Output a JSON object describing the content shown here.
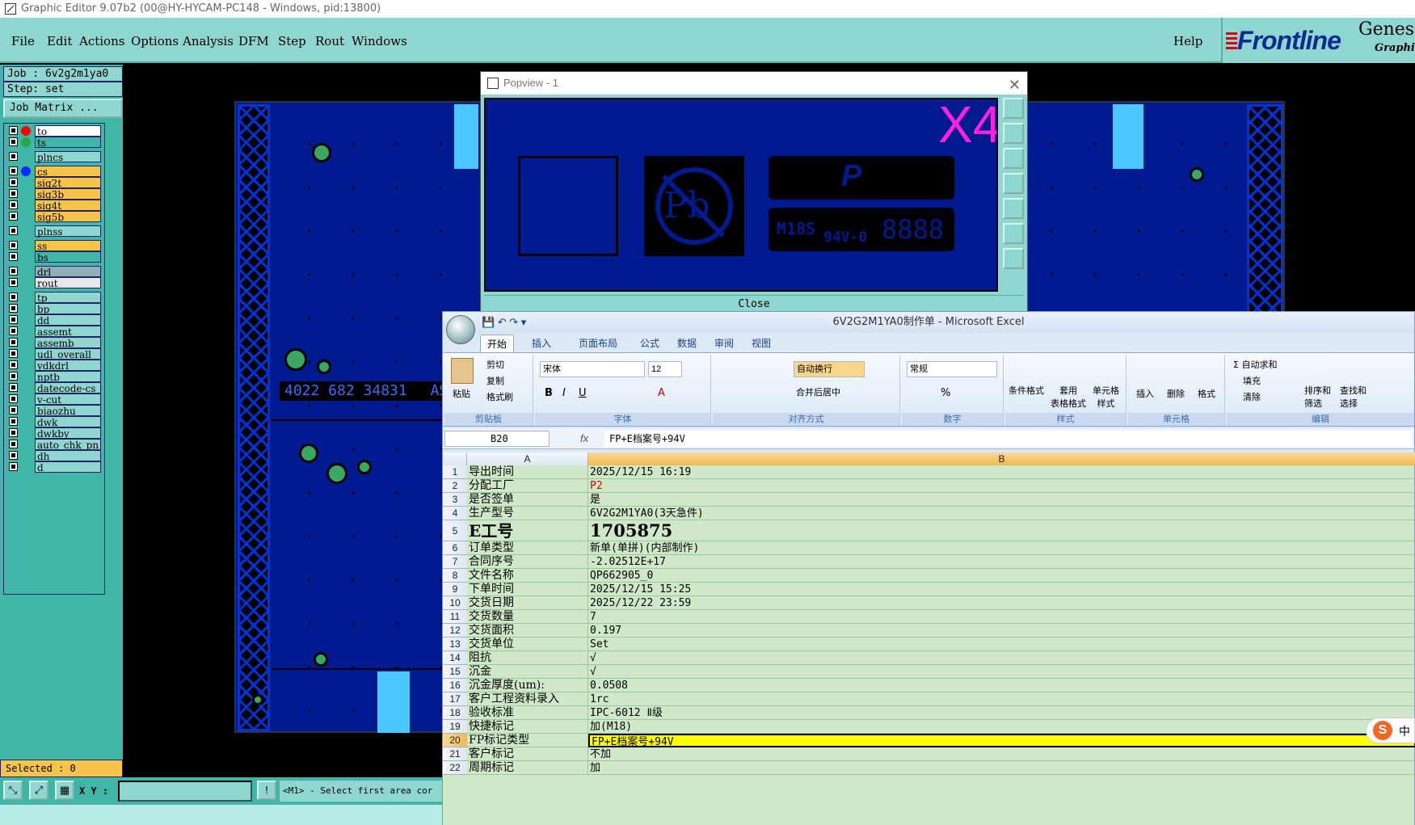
{
  "window": {
    "title": "Graphic Editor 9.07b2 (00@HY-HYCAM-PC148 - Windows, pid:13800)"
  },
  "menubar": {
    "items": [
      "File",
      "Edit",
      "Actions",
      "Options",
      "Analysis",
      "DFM",
      "Step",
      "Rout",
      "Windows"
    ],
    "help": "Help",
    "brand": {
      "logo": "Frontline",
      "product": "Genesis",
      "sub": "Graphic"
    }
  },
  "leftpanel": {
    "job": "Job :  6v2g2m1ya0",
    "step": "Step:  set",
    "job_matrix": "Job Matrix ...",
    "selected": "Selected : 0",
    "layers": [
      {
        "name": "to",
        "color": "#ffffff",
        "dot": "#ff0000"
      },
      {
        "name": "ts",
        "color": "#3fb6a8",
        "dot": "#2aa84a"
      },
      {
        "name": "plncs",
        "color": "#8fd6d0",
        "dot": ""
      },
      {
        "name": "cs",
        "color": "#f7c44a",
        "dot": "#0a2cff"
      },
      {
        "name": "sig2t",
        "color": "#f7c44a",
        "dot": ""
      },
      {
        "name": "sig3b",
        "color": "#f7c44a",
        "dot": ""
      },
      {
        "name": "sig4t",
        "color": "#f7c44a",
        "dot": ""
      },
      {
        "name": "sig5b",
        "color": "#f7c44a",
        "dot": ""
      },
      {
        "name": "plnss",
        "color": "#8fd6d0",
        "dot": ""
      },
      {
        "name": "ss",
        "color": "#f7c44a",
        "dot": ""
      },
      {
        "name": "bs",
        "color": "#3fb6a8",
        "dot": ""
      },
      {
        "name": "drl",
        "color": "#8fb0b8",
        "dot": ""
      },
      {
        "name": "rout",
        "color": "#e8e8e8",
        "dot": ""
      },
      {
        "name": "tp",
        "color": "#8fd6d0",
        "dot": ""
      },
      {
        "name": "bp",
        "color": "#8fd6d0",
        "dot": ""
      },
      {
        "name": "dd",
        "color": "#8fd6d0",
        "dot": ""
      },
      {
        "name": "assemt",
        "color": "#8fd6d0",
        "dot": ""
      },
      {
        "name": "assemb",
        "color": "#8fd6d0",
        "dot": ""
      },
      {
        "name": "udl_overall_",
        "color": "#8fd6d0",
        "dot": ""
      },
      {
        "name": "ydkdrl",
        "color": "#8fd6d0",
        "dot": ""
      },
      {
        "name": "nptb",
        "color": "#8fd6d0",
        "dot": ""
      },
      {
        "name": "datecode-cs",
        "color": "#8fd6d0",
        "dot": ""
      },
      {
        "name": "v-cut",
        "color": "#8fd6d0",
        "dot": ""
      },
      {
        "name": "biaozhu",
        "color": "#8fd6d0",
        "dot": ""
      },
      {
        "name": "dwk",
        "color": "#8fd6d0",
        "dot": ""
      },
      {
        "name": "dwkby",
        "color": "#8fd6d0",
        "dot": ""
      },
      {
        "name": "auto_chk_pn",
        "color": "#8fd6d0",
        "dot": ""
      },
      {
        "name": "dh",
        "color": "#8fd6d0",
        "dot": ""
      },
      {
        "name": "d",
        "color": "#8fd6d0",
        "dot": ""
      }
    ]
  },
  "bottombar": {
    "xy_label": "X Y :",
    "xy_value": "",
    "message": "<M1> - Select first area cor"
  },
  "board": {
    "text": "4022 682 34831",
    "text2": "AS"
  },
  "popview": {
    "title": "Popview - 1",
    "close_label": "Close",
    "marking": "X4",
    "pb": "Pb",
    "m18s": "M18S",
    "rating": "94V-0",
    "digits": "8888"
  },
  "excel": {
    "title": "6V2G2M1YA0制作单 - Microsoft Excel",
    "tabs": [
      "开始",
      "插入",
      "页面布局",
      "公式",
      "数据",
      "审阅",
      "视图"
    ],
    "ribbon": {
      "paste": "粘贴",
      "cut": "剪切",
      "copy": "复制",
      "format_painter": "格式刷",
      "clipboard": "剪贴板",
      "font_name": "宋体",
      "font_size": "12",
      "font": "字体",
      "wrap": "自动换行",
      "merge": "合并后居中",
      "align": "对齐方式",
      "number_format": "常规",
      "number": "数字",
      "cond_format": "条件格式",
      "table_format": "套用\n表格格式",
      "cell_style": "单元格\n样式",
      "styles": "样式",
      "insert": "插入",
      "delete": "删除",
      "format": "格式",
      "cells": "单元格",
      "autosum": "自动求和",
      "fill": "填充",
      "clear": "清除",
      "sort": "排序和\n筛选",
      "find": "查找和\n选择",
      "editing": "编辑"
    },
    "namebox": "B20",
    "fx": "fx",
    "formula": "FP+E档案号+94V",
    "columns": [
      "A",
      "B"
    ],
    "rows": [
      {
        "n": "1",
        "a": "导出时间",
        "b": "2025/12/15 16:19"
      },
      {
        "n": "2",
        "a": "分配工厂",
        "b": "P2"
      },
      {
        "n": "3",
        "a": "是否签单",
        "b": "是"
      },
      {
        "n": "4",
        "a": "生产型号",
        "b": "6V2G2M1YA0(3天急件)"
      },
      {
        "n": "5",
        "a": "E工号",
        "b": "1705875"
      },
      {
        "n": "6",
        "a": "订单类型",
        "b": "新单(单拼)(内部制作)"
      },
      {
        "n": "7",
        "a": "合同序号",
        "b": "-2.02512E+17"
      },
      {
        "n": "8",
        "a": "文件名称",
        "b": "QP662905_0"
      },
      {
        "n": "9",
        "a": "下单时间",
        "b": "2025/12/15 15:25"
      },
      {
        "n": "10",
        "a": "交货日期",
        "b": "2025/12/22 23:59"
      },
      {
        "n": "11",
        "a": "交货数量",
        "b": "7"
      },
      {
        "n": "12",
        "a": "交货面积",
        "b": "0.197"
      },
      {
        "n": "13",
        "a": "交货单位",
        "b": "Set"
      },
      {
        "n": "14",
        "a": "阻抗",
        "b": "√"
      },
      {
        "n": "15",
        "a": "沉金",
        "b": "√"
      },
      {
        "n": "16",
        "a": "沉金厚度(um):",
        "b": "0.0508"
      },
      {
        "n": "17",
        "a": "客户工程资料录入",
        "b": "1rc"
      },
      {
        "n": "18",
        "a": "验收标准",
        "b": "IPC-6012 Ⅱ级"
      },
      {
        "n": "19",
        "a": "快捷标记",
        "b": "加(M18)"
      },
      {
        "n": "20",
        "a": "FP标记类型",
        "b": "FP+E档案号+94V"
      },
      {
        "n": "21",
        "a": "客户标记",
        "b": "不加"
      },
      {
        "n": "22",
        "a": "周期标记",
        "b": "加"
      }
    ],
    "ime": "中"
  }
}
